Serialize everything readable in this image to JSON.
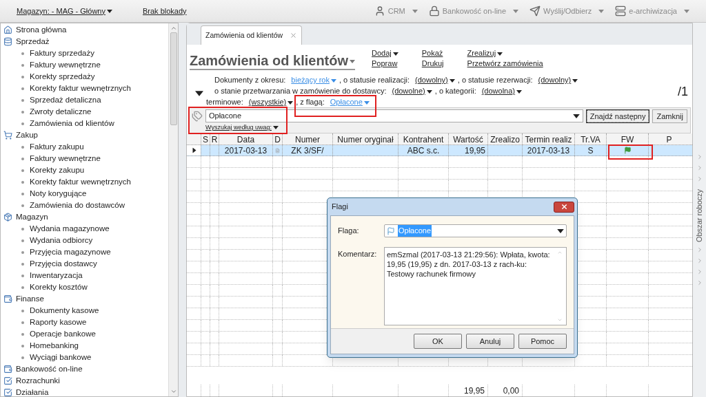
{
  "toolbar": {
    "warehouse": "Magazyn: - MAG - Główny",
    "lock": "Brak blokady",
    "tools": [
      {
        "label": "CRM",
        "kind": "crm"
      },
      {
        "label": "Bankowość on-line",
        "kind": "bank"
      },
      {
        "label": "Wyślij/Odbierz",
        "kind": "send"
      },
      {
        "label": "e-archiwizacja",
        "kind": "archive"
      }
    ]
  },
  "sidebar": {
    "items": [
      {
        "label": "Strona główna",
        "kind": "home"
      },
      {
        "label": "Sprzedaż",
        "kind": "sales",
        "children": [
          {
            "label": "Faktury sprzedaży"
          },
          {
            "label": "Faktury wewnętrzne"
          },
          {
            "label": "Korekty sprzedaży"
          },
          {
            "label": "Korekty faktur wewnętrznych"
          },
          {
            "label": "Sprzedaż detaliczna"
          },
          {
            "label": "Zwroty detaliczne"
          },
          {
            "label": "Zamówienia od klientów"
          }
        ]
      },
      {
        "label": "Zakup",
        "kind": "purchase",
        "children": [
          {
            "label": "Faktury zakupu"
          },
          {
            "label": "Faktury wewnętrzne"
          },
          {
            "label": "Korekty zakupu"
          },
          {
            "label": "Korekty faktur wewnętrznych"
          },
          {
            "label": "Noty korygujące"
          },
          {
            "label": "Zamówienia do dostawców"
          }
        ]
      },
      {
        "label": "Magazyn",
        "kind": "warehouse",
        "children": [
          {
            "label": "Wydania magazynowe"
          },
          {
            "label": "Wydania odbiorcy"
          },
          {
            "label": "Przyjęcia magazynowe"
          },
          {
            "label": "Przyjęcia dostawcy"
          },
          {
            "label": "Inwentaryzacja"
          },
          {
            "label": "Korekty kosztów"
          }
        ]
      },
      {
        "label": "Finanse",
        "kind": "finance",
        "children": [
          {
            "label": "Dokumenty kasowe"
          },
          {
            "label": "Raporty kasowe"
          },
          {
            "label": "Operacje bankowe"
          },
          {
            "label": "Homebanking"
          },
          {
            "label": "Wyciągi bankowe"
          }
        ]
      },
      {
        "label": "Bankowość on-line",
        "kind": "finance"
      },
      {
        "label": "Rozrachunki",
        "kind": "check"
      },
      {
        "label": "Działania",
        "kind": "check"
      }
    ]
  },
  "tab": {
    "label": "Zamówienia od klientów"
  },
  "title": "Zamówienia od klientów",
  "actions": [
    {
      "label": "Dodaj",
      "has_menu": true
    },
    {
      "label": "Popraw",
      "has_menu": false
    },
    {
      "label": "Pokaż",
      "has_menu": false
    },
    {
      "label": "Drukuj",
      "has_menu": false
    },
    {
      "label": "Zrealizuj",
      "has_menu": true
    },
    {
      "label": "Przetwórz zamówienia",
      "has_menu": false
    }
  ],
  "filters": [
    [
      {
        "label": "Dokumenty z okresu:",
        "value": "bieżący rok",
        "active": true
      },
      {
        "label": ", o statusie realizacji:",
        "value": "(dowolny)",
        "active": false
      },
      {
        "label": ", o statusie rezerwacji:",
        "value": "(dowolny)",
        "active": false
      }
    ],
    [
      {
        "label": "o stanie przetwarzania w zamówienie do dostawcy:",
        "value": "(dowolne)",
        "active": false
      },
      {
        "label": ", o kategorii:",
        "value": "(dowolna)",
        "active": false
      }
    ],
    [
      {
        "label": "terminowe:",
        "value": "(wszystkie)",
        "active": false
      },
      {
        "label": ", z flagą:",
        "value": "Opłacone",
        "active": true
      }
    ]
  ],
  "page_count": "/1",
  "search": {
    "value": "Opłacone",
    "mode": "Wyszukaj według uwag:",
    "buttons": [
      "Znajdź następny",
      "Zamknij"
    ]
  },
  "table": {
    "columns": [
      "S",
      "R",
      "Data",
      "D",
      "Numer",
      "Numer oryginał",
      "Kontrahent",
      "Wartość",
      "Zrealizo",
      "Termin realiz",
      "Tr.VA",
      "FW",
      "P"
    ],
    "rows": [
      {
        "selected": true,
        "date": "2017-03-13",
        "number": "ZK 3/SF/",
        "contractor": "ABC s.c.",
        "value": "19,95",
        "due_date": "2017-03-13",
        "vat_type": "S",
        "flagged": true
      }
    ],
    "totals": {
      "value": "19,95",
      "realized": "0,00"
    }
  },
  "side_panel": {
    "label": "Obszar roboczy"
  },
  "dialog": {
    "title": "Flagi",
    "flag_label": "Flaga:",
    "flag_value": "Opłacone",
    "comment_label": "Komentarz:",
    "comment": "emSzmal (2017-03-13 21:29:56): Wpłata, kwota: 19,95 (19,95) z dn. 2017-03-13 z rach-ku: Testowy rachunek firmowy",
    "buttons": [
      "OK",
      "Anuluj",
      "Pomoc"
    ]
  }
}
